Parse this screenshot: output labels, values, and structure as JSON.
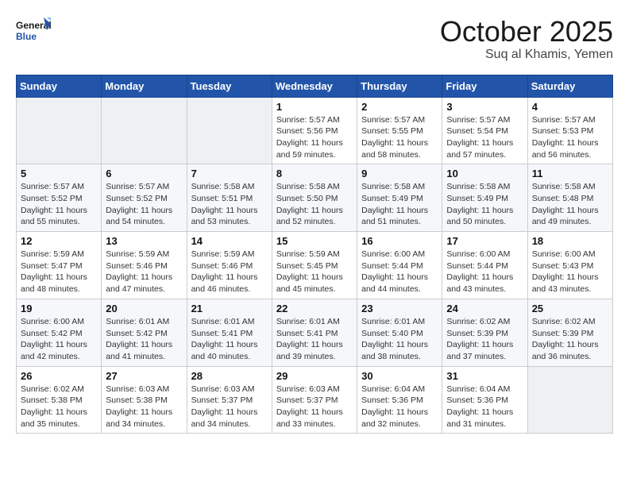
{
  "logo": {
    "general": "General",
    "blue": "Blue"
  },
  "title": "October 2025",
  "location": "Suq al Khamis, Yemen",
  "days_header": [
    "Sunday",
    "Monday",
    "Tuesday",
    "Wednesday",
    "Thursday",
    "Friday",
    "Saturday"
  ],
  "weeks": [
    [
      {
        "day": "",
        "info": ""
      },
      {
        "day": "",
        "info": ""
      },
      {
        "day": "",
        "info": ""
      },
      {
        "day": "1",
        "info": "Sunrise: 5:57 AM\nSunset: 5:56 PM\nDaylight: 11 hours\nand 59 minutes."
      },
      {
        "day": "2",
        "info": "Sunrise: 5:57 AM\nSunset: 5:55 PM\nDaylight: 11 hours\nand 58 minutes."
      },
      {
        "day": "3",
        "info": "Sunrise: 5:57 AM\nSunset: 5:54 PM\nDaylight: 11 hours\nand 57 minutes."
      },
      {
        "day": "4",
        "info": "Sunrise: 5:57 AM\nSunset: 5:53 PM\nDaylight: 11 hours\nand 56 minutes."
      }
    ],
    [
      {
        "day": "5",
        "info": "Sunrise: 5:57 AM\nSunset: 5:52 PM\nDaylight: 11 hours\nand 55 minutes."
      },
      {
        "day": "6",
        "info": "Sunrise: 5:57 AM\nSunset: 5:52 PM\nDaylight: 11 hours\nand 54 minutes."
      },
      {
        "day": "7",
        "info": "Sunrise: 5:58 AM\nSunset: 5:51 PM\nDaylight: 11 hours\nand 53 minutes."
      },
      {
        "day": "8",
        "info": "Sunrise: 5:58 AM\nSunset: 5:50 PM\nDaylight: 11 hours\nand 52 minutes."
      },
      {
        "day": "9",
        "info": "Sunrise: 5:58 AM\nSunset: 5:49 PM\nDaylight: 11 hours\nand 51 minutes."
      },
      {
        "day": "10",
        "info": "Sunrise: 5:58 AM\nSunset: 5:49 PM\nDaylight: 11 hours\nand 50 minutes."
      },
      {
        "day": "11",
        "info": "Sunrise: 5:58 AM\nSunset: 5:48 PM\nDaylight: 11 hours\nand 49 minutes."
      }
    ],
    [
      {
        "day": "12",
        "info": "Sunrise: 5:59 AM\nSunset: 5:47 PM\nDaylight: 11 hours\nand 48 minutes."
      },
      {
        "day": "13",
        "info": "Sunrise: 5:59 AM\nSunset: 5:46 PM\nDaylight: 11 hours\nand 47 minutes."
      },
      {
        "day": "14",
        "info": "Sunrise: 5:59 AM\nSunset: 5:46 PM\nDaylight: 11 hours\nand 46 minutes."
      },
      {
        "day": "15",
        "info": "Sunrise: 5:59 AM\nSunset: 5:45 PM\nDaylight: 11 hours\nand 45 minutes."
      },
      {
        "day": "16",
        "info": "Sunrise: 6:00 AM\nSunset: 5:44 PM\nDaylight: 11 hours\nand 44 minutes."
      },
      {
        "day": "17",
        "info": "Sunrise: 6:00 AM\nSunset: 5:44 PM\nDaylight: 11 hours\nand 43 minutes."
      },
      {
        "day": "18",
        "info": "Sunrise: 6:00 AM\nSunset: 5:43 PM\nDaylight: 11 hours\nand 43 minutes."
      }
    ],
    [
      {
        "day": "19",
        "info": "Sunrise: 6:00 AM\nSunset: 5:42 PM\nDaylight: 11 hours\nand 42 minutes."
      },
      {
        "day": "20",
        "info": "Sunrise: 6:01 AM\nSunset: 5:42 PM\nDaylight: 11 hours\nand 41 minutes."
      },
      {
        "day": "21",
        "info": "Sunrise: 6:01 AM\nSunset: 5:41 PM\nDaylight: 11 hours\nand 40 minutes."
      },
      {
        "day": "22",
        "info": "Sunrise: 6:01 AM\nSunset: 5:41 PM\nDaylight: 11 hours\nand 39 minutes."
      },
      {
        "day": "23",
        "info": "Sunrise: 6:01 AM\nSunset: 5:40 PM\nDaylight: 11 hours\nand 38 minutes."
      },
      {
        "day": "24",
        "info": "Sunrise: 6:02 AM\nSunset: 5:39 PM\nDaylight: 11 hours\nand 37 minutes."
      },
      {
        "day": "25",
        "info": "Sunrise: 6:02 AM\nSunset: 5:39 PM\nDaylight: 11 hours\nand 36 minutes."
      }
    ],
    [
      {
        "day": "26",
        "info": "Sunrise: 6:02 AM\nSunset: 5:38 PM\nDaylight: 11 hours\nand 35 minutes."
      },
      {
        "day": "27",
        "info": "Sunrise: 6:03 AM\nSunset: 5:38 PM\nDaylight: 11 hours\nand 34 minutes."
      },
      {
        "day": "28",
        "info": "Sunrise: 6:03 AM\nSunset: 5:37 PM\nDaylight: 11 hours\nand 34 minutes."
      },
      {
        "day": "29",
        "info": "Sunrise: 6:03 AM\nSunset: 5:37 PM\nDaylight: 11 hours\nand 33 minutes."
      },
      {
        "day": "30",
        "info": "Sunrise: 6:04 AM\nSunset: 5:36 PM\nDaylight: 11 hours\nand 32 minutes."
      },
      {
        "day": "31",
        "info": "Sunrise: 6:04 AM\nSunset: 5:36 PM\nDaylight: 11 hours\nand 31 minutes."
      },
      {
        "day": "",
        "info": ""
      }
    ]
  ]
}
